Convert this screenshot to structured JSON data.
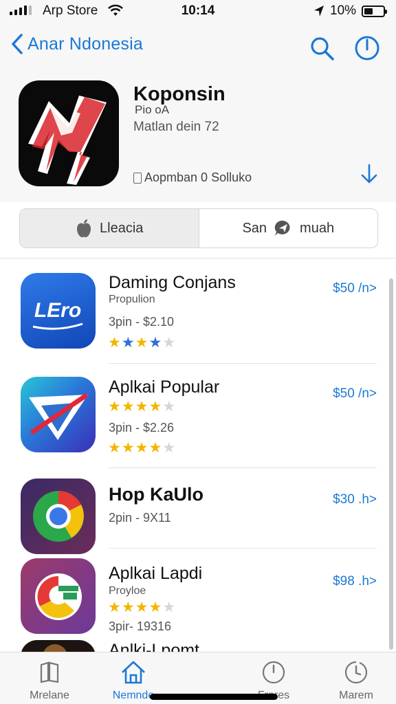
{
  "status": {
    "carrier": "Arp Store",
    "time": "10:14",
    "battery": "10%"
  },
  "nav": {
    "back_label": "Anar Ndonesia"
  },
  "app": {
    "title": "Koponsin",
    "subtitle": "Pio oA",
    "detail": "Matlan dein 72",
    "meta": "Aopmban 0 Solluko"
  },
  "segments": [
    {
      "label": "Lleacia"
    },
    {
      "label": "San",
      "label2": "muah"
    }
  ],
  "list": [
    {
      "title": "Daming Conjans",
      "line1": "Propulion",
      "line2": "3pin - $2.10",
      "price": "$50 /n>",
      "rating": 4,
      "icon_text": "LEro"
    },
    {
      "title": "Aplkai Popular",
      "line2": "3pin - $2.26",
      "price": "$50 /n>",
      "rating": 4
    },
    {
      "title": "Hop KaUlo",
      "line1": "2pin - 9X11",
      "price": "$30 .h>"
    },
    {
      "title": "Aplkai Lapdi",
      "line1": "Proyloe",
      "line2": "3pir- 19316",
      "price": "$98 .h>",
      "rating": 4
    },
    {
      "title": "Anlki-Lpomt"
    }
  ],
  "tabs": [
    {
      "label": "Mrelane"
    },
    {
      "label": "Nemnde"
    },
    {
      "label": "Frnres"
    },
    {
      "label": "Marem"
    }
  ],
  "colors": {
    "accent": "#1a78d6",
    "star": "#f2b600"
  }
}
